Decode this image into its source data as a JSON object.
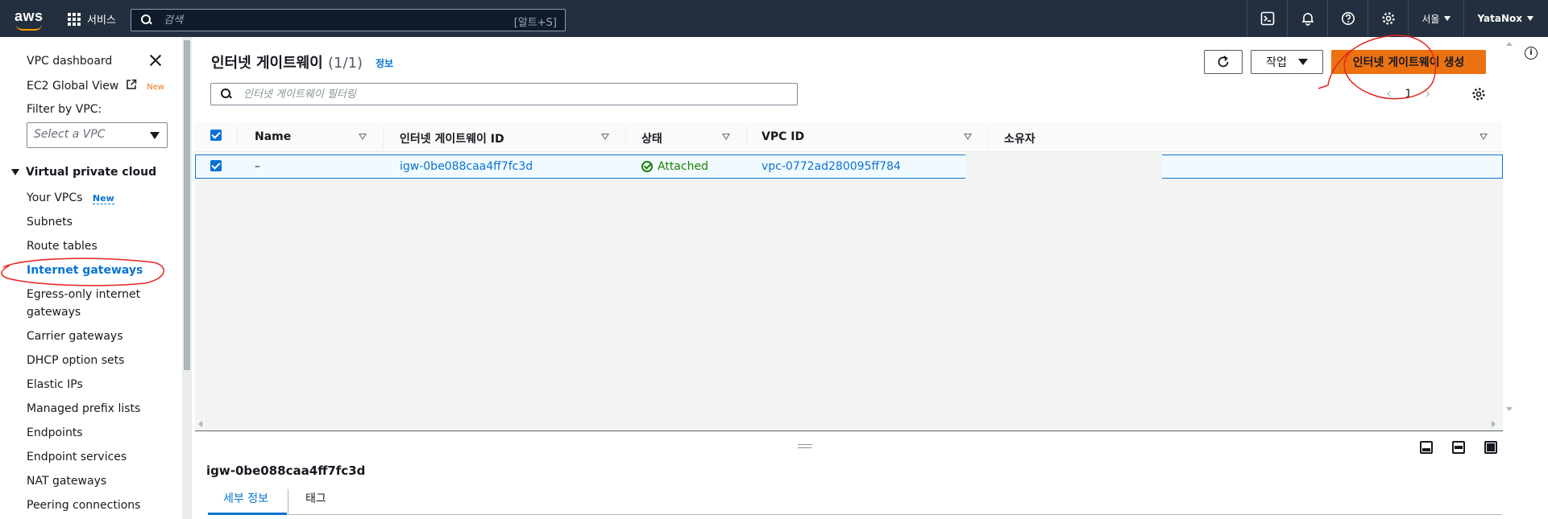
{
  "topbar": {
    "logo_text": "aws",
    "services_label": "서비스",
    "search_placeholder": "검색",
    "search_shortcut": "[알트+S]",
    "region_label": "서울",
    "user_label": "YataNox"
  },
  "sidebar": {
    "dashboard": "VPC dashboard",
    "ec2_global": "EC2 Global View",
    "ec2_new": "New",
    "filter_label": "Filter by VPC:",
    "vpc_select": "Select a VPC",
    "section": "Virtual private cloud",
    "your_vpcs": "Your VPCs",
    "your_vpcs_new": "New",
    "subnets": "Subnets",
    "route_tables": "Route tables",
    "internet_gateways": "Internet gateways",
    "egress_1": "Egress-only internet",
    "egress_2": "gateways",
    "carrier": "Carrier gateways",
    "dhcp": "DHCP option sets",
    "elastic_ips": "Elastic IPs",
    "prefix_lists": "Managed prefix lists",
    "endpoints": "Endpoints",
    "endpoint_services": "Endpoint services",
    "nat": "NAT gateways",
    "peering": "Peering connections"
  },
  "main": {
    "title": "인터넷 게이트웨이",
    "count": "(1/1)",
    "info": "정보",
    "action_label": "작업",
    "create_label": "인터넷 게이트웨이 생성",
    "filter_placeholder": "인터넷 게이트웨이 필터링",
    "page_number": "1"
  },
  "table": {
    "columns": [
      "Name",
      "인터넷 게이트웨이 ID",
      "상태",
      "VPC ID",
      "소유자"
    ],
    "row": {
      "name": "–",
      "igw_id": "igw-0be088caa4ff7fc3d",
      "status": "Attached",
      "vpc_id": "vpc-0772ad280095ff784"
    }
  },
  "details": {
    "title": "igw-0be088caa4ff7fc3d",
    "tab_details": "세부 정보",
    "tab_tags": "태그"
  },
  "colors": {
    "topbar_bg": "#232f3e",
    "accent_orange": "#ec7211",
    "link_blue": "#0972d3",
    "ok_green": "#1d8102",
    "annotation_red": "#e5261f"
  }
}
